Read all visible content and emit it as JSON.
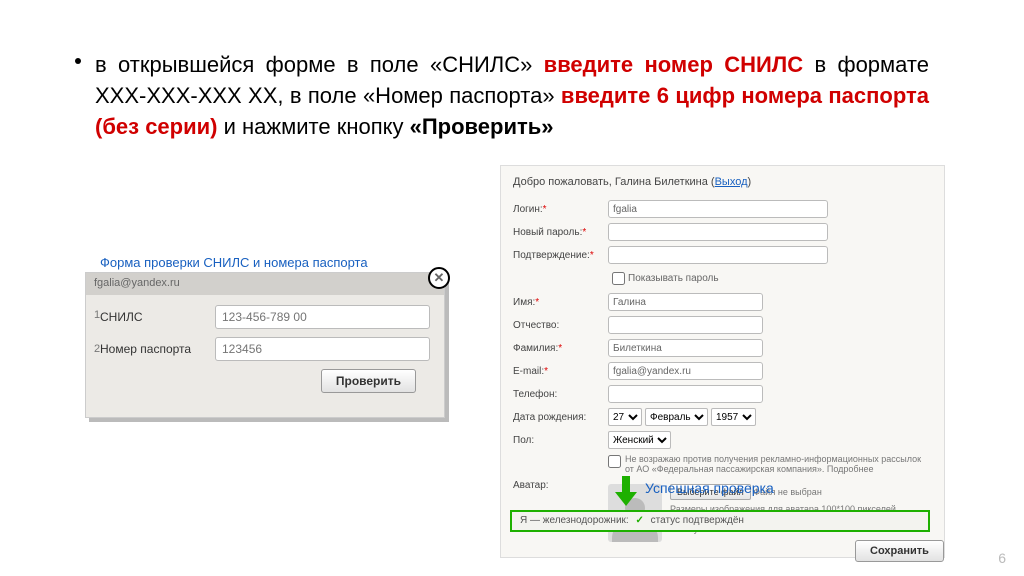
{
  "instruction": {
    "part1": "в открывшейся форме в поле «СНИЛС» ",
    "red1": "введите номер СНИЛС",
    "part2": " в формате ХХХ-ХХХ-ХХХ ХХ, в поле «Номер паспорта» ",
    "red2": "введите 6 цифр номера паспорта (без серии)",
    "part3": " и нажмите кнопку ",
    "bold": "«Проверить»"
  },
  "form_caption": "Форма проверки СНИЛС и номера паспорта",
  "snils": {
    "header": "fgalia@yandex.ru",
    "label_snils": "СНИЛС",
    "placeholder_snils": "123-456-789 00",
    "label_passport": "Номер паспорта",
    "placeholder_passport": "123456",
    "verify": "Проверить",
    "side1": "1",
    "side2": "2"
  },
  "profile": {
    "welcome_pre": "Добро пожаловать, ",
    "welcome_name": "Галина Билеткина",
    "logout": "Выход",
    "login_lbl": "Логин:",
    "login_val": "fgalia",
    "newpass_lbl": "Новый пароль:",
    "confirm_lbl": "Подтверждение:",
    "show_pass": "Показывать пароль",
    "name_lbl": "Имя:",
    "name_val": "Галина",
    "patronymic_lbl": "Отчество:",
    "surname_lbl": "Фамилия:",
    "surname_val": "Билеткина",
    "email_lbl": "E-mail:",
    "email_val": "fgalia@yandex.ru",
    "phone_lbl": "Телефон:",
    "dob_lbl": "Дата рождения:",
    "dob_day": "27",
    "dob_month": "Февраль",
    "dob_year": "1957",
    "gender_lbl": "Пол:",
    "gender_val": "Женский",
    "consent": "Не возражаю против получения рекламно-информационных рассылок от АО «Федеральная пассажирская компания». Подробнее",
    "avatar_lbl": "Аватар:",
    "file_btn": "Выберите файл",
    "file_none": "Файл не выбран",
    "avatar_hint": "Размеры изображения для аватара 100*100 пикселей, до 30 Кбайт. Новый аватар появится на сайте через 3-5 минут."
  },
  "success_label": "Успешная проверка",
  "status": {
    "prefix": "Я — железнодорожник:",
    "text": "статус подтверждён"
  },
  "save": "Сохранить",
  "page": "6"
}
